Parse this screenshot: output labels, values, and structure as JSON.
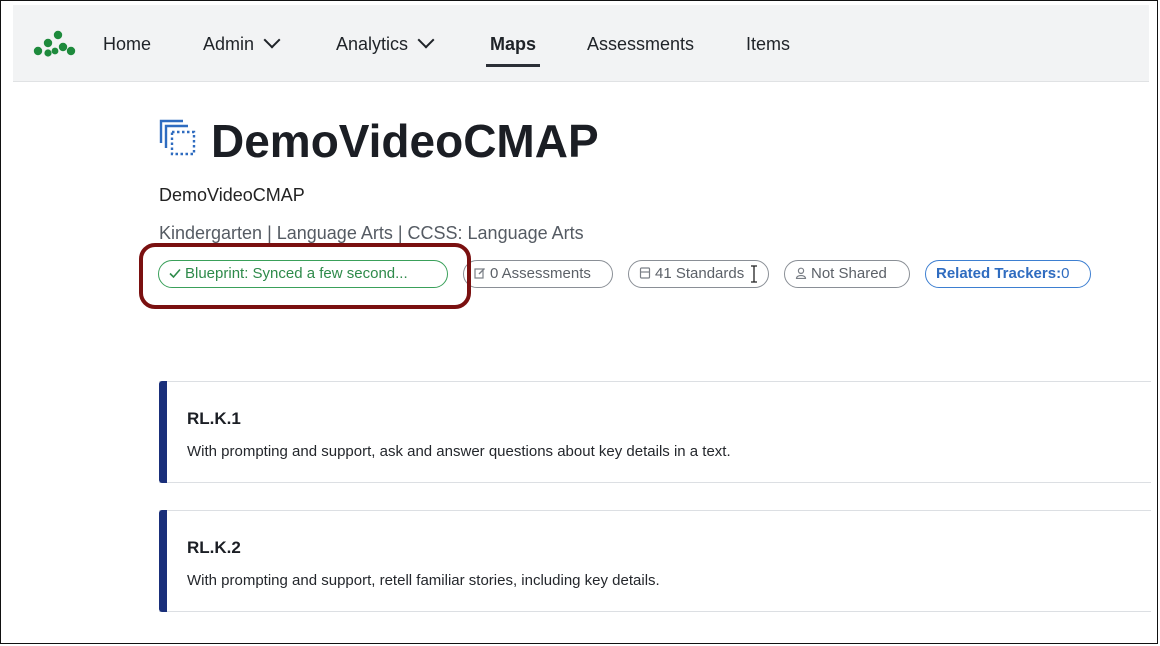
{
  "nav": {
    "logo_icon": "dots-network-logo-icon",
    "items": [
      {
        "label": "Home"
      },
      {
        "label": "Admin",
        "has_dropdown": true
      },
      {
        "label": "Analytics",
        "has_dropdown": true
      },
      {
        "label": "Maps",
        "active": true
      },
      {
        "label": "Assessments"
      },
      {
        "label": "Items"
      }
    ]
  },
  "header": {
    "icon": "stacked-squares-icon",
    "title": "DemoVideoCMAP",
    "subtitle": "DemoVideoCMAP",
    "meta": "Kindergarten | Language Arts | CCSS: Language Arts"
  },
  "chips": {
    "blueprint": {
      "label": "Blueprint: Synced a few second...",
      "icon": "check-icon"
    },
    "assessments": {
      "label": "0 Assessments",
      "icon": "edit-icon"
    },
    "standards": {
      "label": "41 Standards",
      "icon": "document-icon"
    },
    "shared": {
      "label": "Not Shared",
      "icon": "user-icon"
    },
    "trackers": {
      "label": "Related Trackers:",
      "count": "0"
    }
  },
  "standards": [
    {
      "code": "RL.K.1",
      "description": "With prompting and support, ask and answer questions about key details in a text."
    },
    {
      "code": "RL.K.2",
      "description": "With prompting and support, retell familiar stories, including key details."
    }
  ],
  "colors": {
    "accent_green": "#3aa05a",
    "accent_blue": "#3d7fd1",
    "card_bar": "#1a2f7a",
    "highlight_box": "#7a1010",
    "logo_green": "#1e8a3c"
  }
}
